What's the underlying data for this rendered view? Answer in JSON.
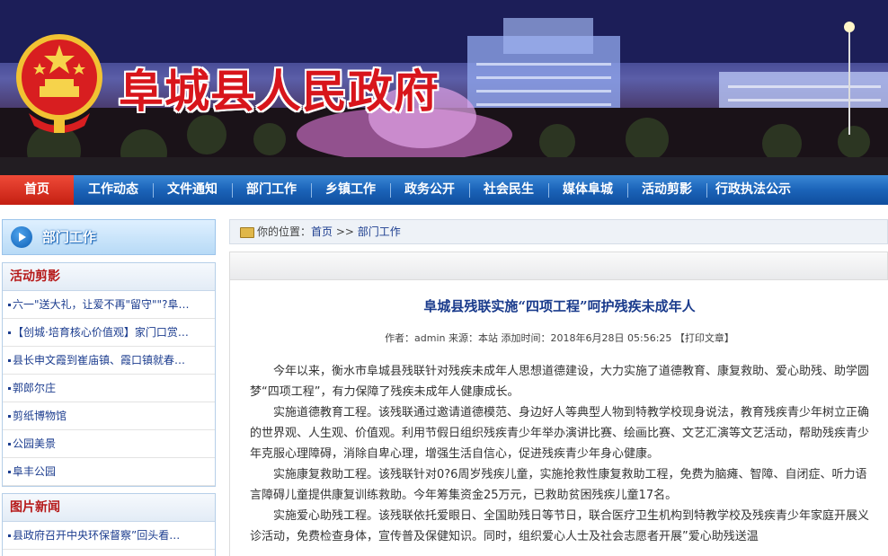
{
  "header": {
    "site_title": "阜城县人民政府"
  },
  "nav": {
    "items": [
      "首页",
      "工作动态",
      "文件通知",
      "部门工作",
      "乡镇工作",
      "政务公开",
      "社会民生",
      "媒体阜城",
      "活动剪影",
      "行政执法公示"
    ],
    "active_index": 0
  },
  "sidebar": {
    "header_label": "部门工作",
    "sections": [
      {
        "title": "活动剪影",
        "items": [
          "六一\"送大礼，让爱不再\"留守\"\"?阜…",
          "【创城·培育核心价值观】家门口赏…",
          "县长申文霞到崔庙镇、霞口镇就春…",
          "郭郎尔庄",
          "剪纸博物馆",
          "公园美景",
          "阜丰公园"
        ]
      },
      {
        "title": "图片新闻",
        "items": [
          "县政府召开中央环保督察”回头看…"
        ]
      }
    ]
  },
  "breadcrumb": {
    "prefix": "你的位置：",
    "home": "首页",
    "sep": " >> ",
    "current": "部门工作"
  },
  "article": {
    "title": "阜城县残联实施“四项工程”呵护残疾未成年人",
    "meta": "作者：admin  来源：本站  添加时间：2018年6月28日 05:56:25  【打印文章】",
    "paragraphs": [
      "今年以来，衡水市阜城县残联针对残疾未成年人思想道德建设，大力实施了道德教育、康复救助、爱心助残、助学圆梦“四项工程”，有力保障了残疾未成年人健康成长。",
      "实施道德教育工程。该残联通过邀请道德模范、身边好人等典型人物到特教学校现身说法，教育残疾青少年树立正确的世界观、人生观、价值观。利用节假日组织残疾青少年举办演讲比赛、绘画比赛、文艺汇演等文艺活动，帮助残疾青少年克服心理障碍，消除自卑心理，增强生活自信心，促进残疾青少年身心健康。",
      "实施康复救助工程。该残联针对0?6周岁残疾儿童，实施抢救性康复救助工程，免费为脑瘫、智障、自闭症、听力语言障碍儿童提供康复训练救助。今年筹集资金25万元，已救助贫困残疾儿童17名。",
      "实施爱心助残工程。该残联依托爱眼日、全国助残日等节日，联合医疗卫生机构到特教学校及残疾青少年家庭开展义诊活动，免费检查身体，宣传普及保健知识。同时，组织爱心人士及社会志愿者开展”爱心助残送温"
    ]
  },
  "colors": {
    "nav_blue": "#1b63b8",
    "nav_active_red": "#c41f12",
    "title_red": "#d8151b",
    "link_blue": "#1c3d8f"
  }
}
